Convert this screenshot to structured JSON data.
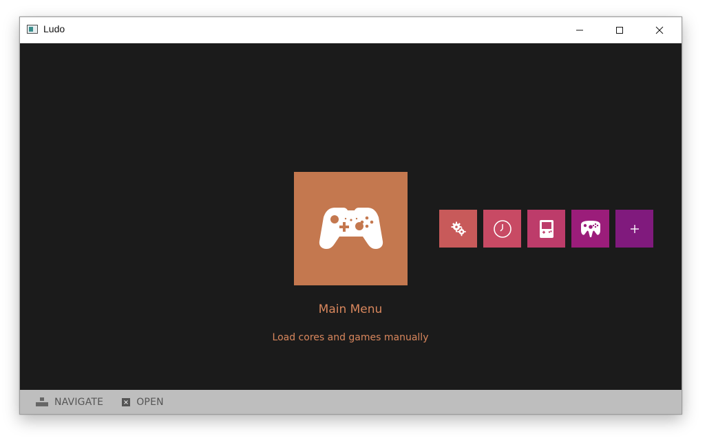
{
  "window": {
    "title": "Ludo"
  },
  "main": {
    "title": "Main Menu",
    "subtitle": "Load cores and games manually",
    "icon": "gamepad-icon"
  },
  "tiles": [
    {
      "name": "settings",
      "icon": "gears-icon",
      "color": "#c85a5a"
    },
    {
      "name": "history",
      "icon": "clock-icon",
      "color": "#c84a64"
    },
    {
      "name": "handheld",
      "icon": "handheld-console-icon",
      "color": "#bd3c6a"
    },
    {
      "name": "console",
      "icon": "n64-controller-icon",
      "color": "#9b1d7a"
    },
    {
      "name": "add",
      "icon": "plus-icon",
      "color": "#801a7d"
    }
  ],
  "hints": [
    {
      "icon": "dpad-icon",
      "label": "NAVIGATE"
    },
    {
      "icon": "x-button-icon",
      "label": "OPEN"
    }
  ]
}
